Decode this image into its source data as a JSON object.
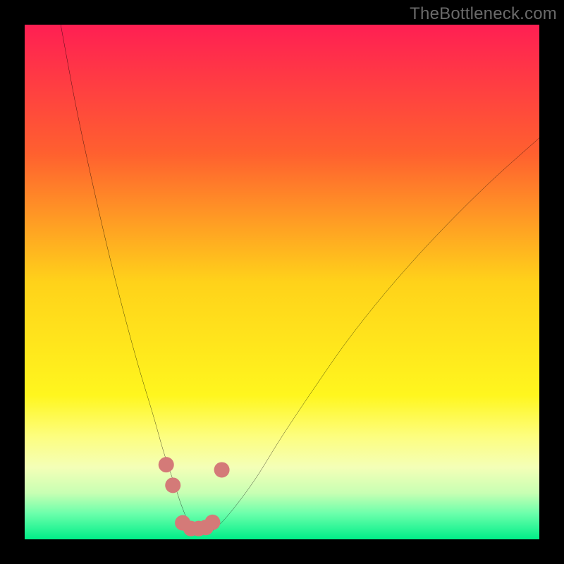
{
  "watermark": "TheBottleneck.com",
  "chart_data": {
    "type": "line",
    "title": "",
    "xlabel": "",
    "ylabel": "",
    "xlim": [
      0,
      100
    ],
    "ylim": [
      0,
      100
    ],
    "grid": false,
    "legend": false,
    "background": {
      "type": "vertical-gradient",
      "stops": [
        {
          "offset": 0,
          "color": "#ff1f53"
        },
        {
          "offset": 25,
          "color": "#ff602f"
        },
        {
          "offset": 50,
          "color": "#ffd21a"
        },
        {
          "offset": 72,
          "color": "#fff61e"
        },
        {
          "offset": 80,
          "color": "#fdfe7f"
        },
        {
          "offset": 86,
          "color": "#f4ffb7"
        },
        {
          "offset": 91,
          "color": "#c8ffb3"
        },
        {
          "offset": 95,
          "color": "#6bffab"
        },
        {
          "offset": 100,
          "color": "#00ee88"
        }
      ]
    },
    "series": [
      {
        "name": "bottleneck-curve",
        "type": "line",
        "color": "#000000",
        "x": [
          7,
          10,
          13,
          16,
          19,
          22,
          25,
          27,
          29,
          30.5,
          32,
          33.4,
          34.5,
          36,
          38,
          41,
          45,
          50,
          56,
          63,
          71,
          80,
          90,
          100
        ],
        "y": [
          100,
          84,
          70,
          57,
          45,
          34,
          24,
          17,
          11,
          6.5,
          3,
          1.4,
          1.2,
          1.4,
          3,
          6.5,
          12,
          20,
          29,
          39,
          49,
          59,
          69,
          78
        ]
      },
      {
        "name": "highlight-markers",
        "type": "scatter",
        "color": "#d47a78",
        "marker_radius": 11,
        "x": [
          27.5,
          28.8,
          30.7,
          32.3,
          33.8,
          35.2,
          36.5,
          38.3
        ],
        "y": [
          14.5,
          10.5,
          3.2,
          2.1,
          2.1,
          2.3,
          3.3,
          13.5
        ]
      }
    ]
  }
}
